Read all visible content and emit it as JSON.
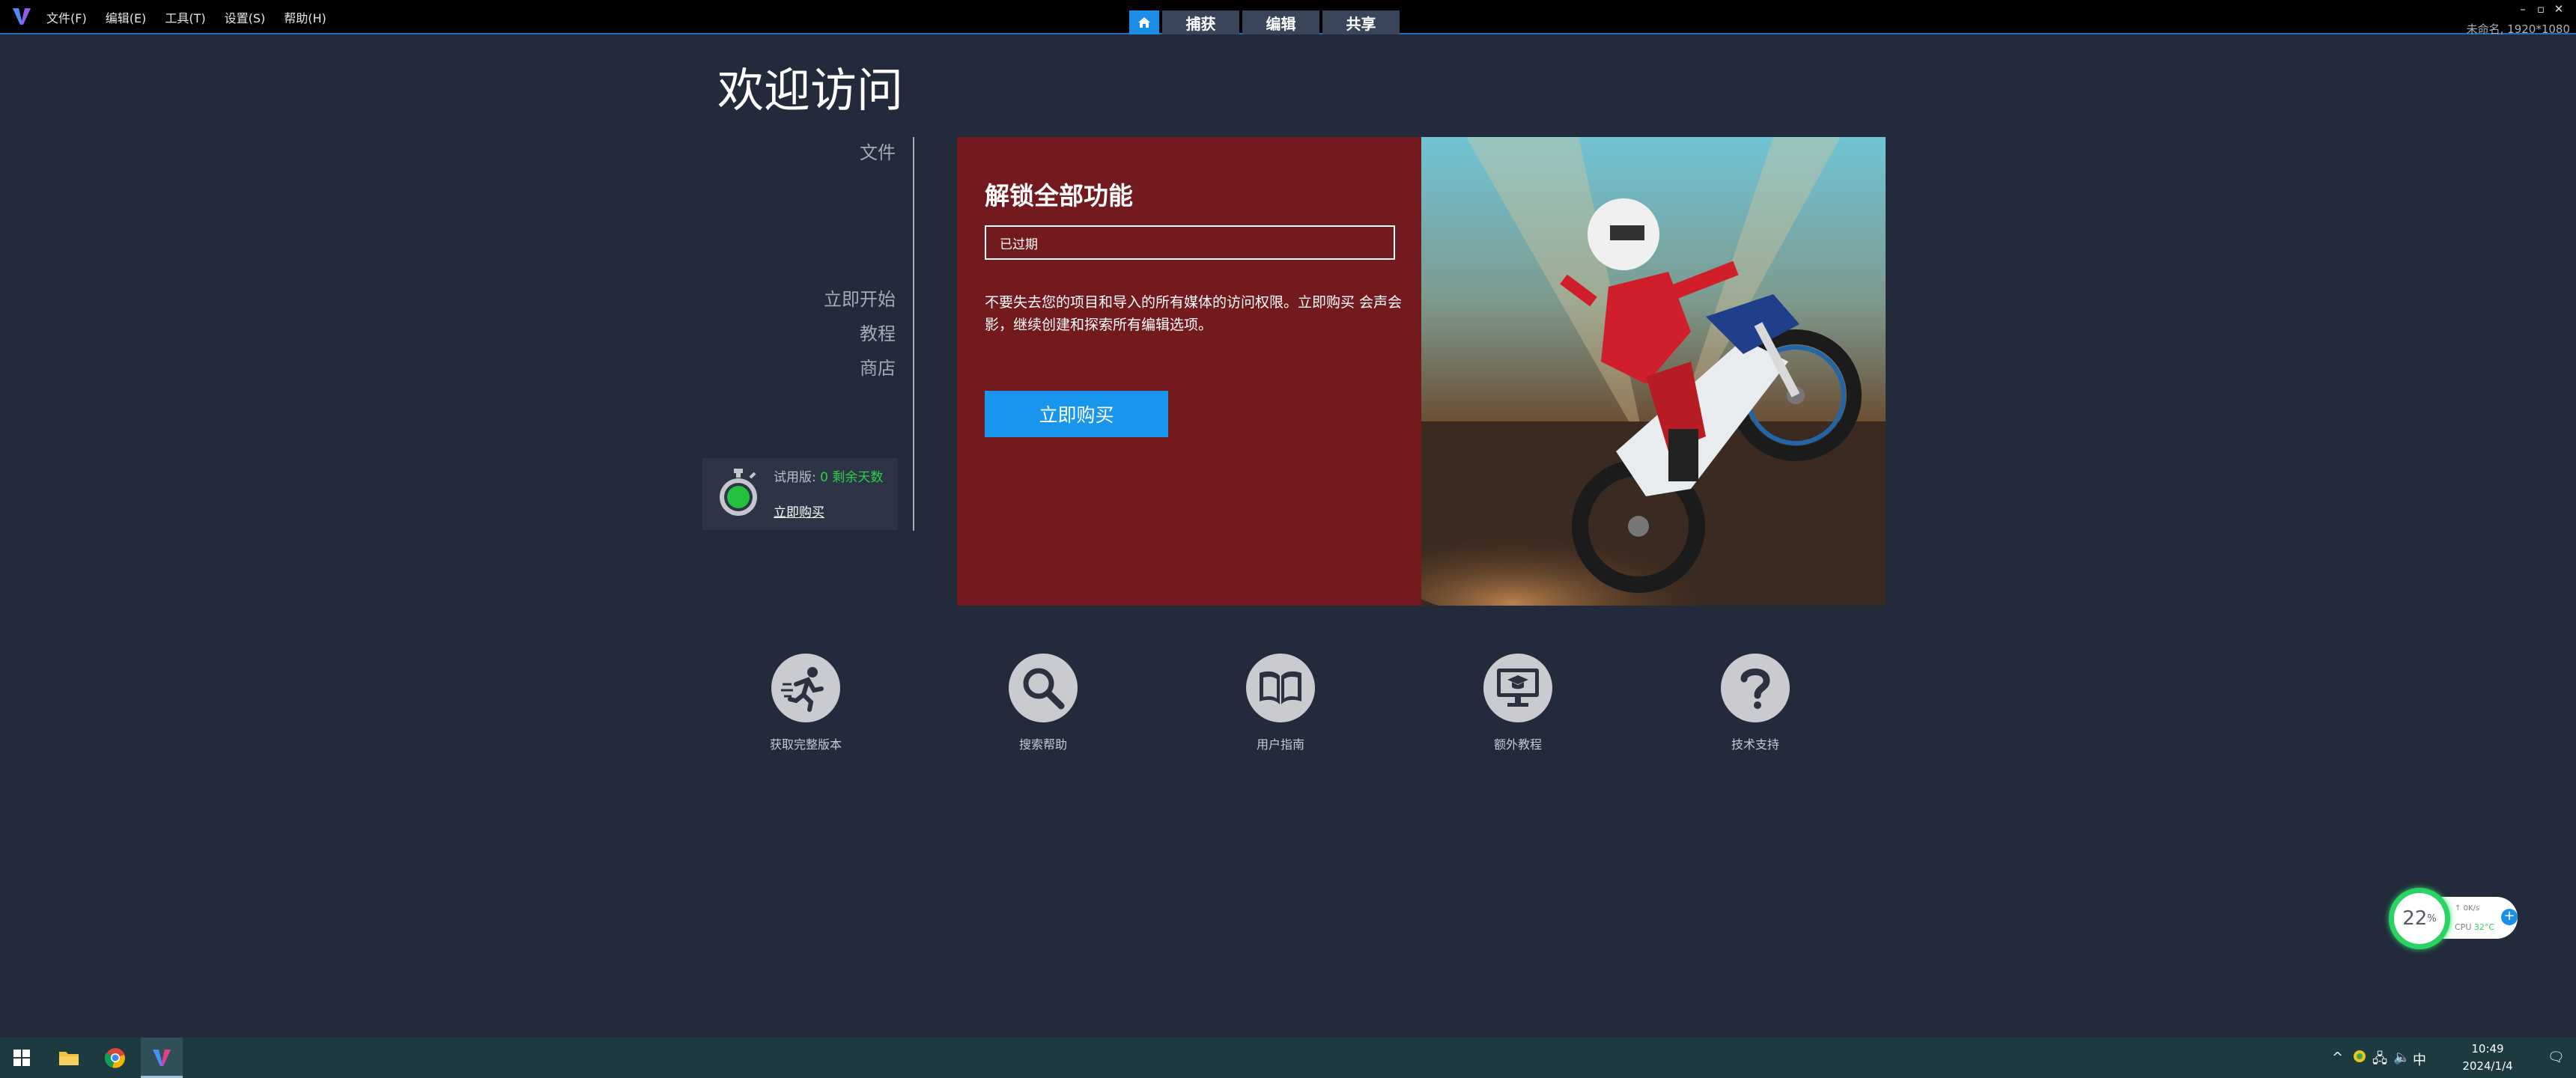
{
  "menubar": {
    "items": [
      "文件(F)",
      "编辑(E)",
      "工具(T)",
      "设置(S)",
      "帮助(H)"
    ],
    "tabs": [
      "捕获",
      "编辑",
      "共享"
    ],
    "project_info": "未命名, 1920*1080",
    "window_controls": [
      "minimize-icon",
      "restore-icon",
      "close-icon"
    ]
  },
  "welcome": {
    "title": "欢迎访问",
    "nav": {
      "file": "文件",
      "get_started": "立即开始",
      "tutorials": "教程",
      "store": "商店"
    },
    "trial": {
      "label": "试用版:",
      "days": "0 剩余天数",
      "buy_link": "立即购买"
    }
  },
  "promo": {
    "title": "解锁全部功能",
    "status": "已过期",
    "description": "不要失去您的项目和导入的所有媒体的访问权限。立即购买 会声会影，继续创建和探索所有编辑选项。",
    "buy_button": "立即购买"
  },
  "quick_links": [
    {
      "label": "获取完整版本",
      "icon": "running-man-icon"
    },
    {
      "label": "搜索帮助",
      "icon": "search-icon"
    },
    {
      "label": "用户指南",
      "icon": "book-icon"
    },
    {
      "label": "额外教程",
      "icon": "monitor-graduation-icon"
    },
    {
      "label": "技术支持",
      "icon": "question-icon"
    }
  ],
  "monitor": {
    "percent_value": "22",
    "percent_sign": "%",
    "net": "0K/s",
    "cpu_label": "CPU",
    "cpu_temp": "32°C",
    "colors": {
      "ring": "#2bd363",
      "plus": "#1a8fe8"
    }
  },
  "taskbar": {
    "apps": [
      "file-explorer-icon",
      "chrome-icon",
      "videostudio-icon"
    ],
    "ime": "中",
    "time": "10:49",
    "date": "2024/1/4"
  },
  "colors": {
    "background": "#222a3b",
    "promo_bg": "#731a1e",
    "accent": "#1896ee",
    "trial_green": "#2fcf48"
  }
}
